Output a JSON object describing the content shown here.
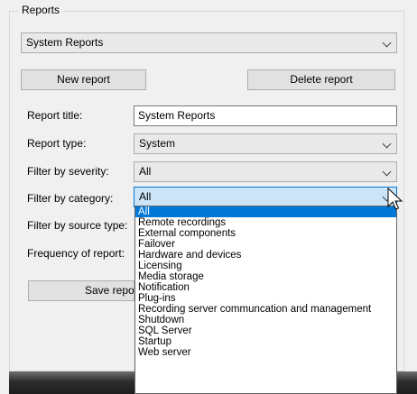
{
  "reports_group": {
    "title": "Reports",
    "selected_report": "System Reports",
    "new_report_label": "New report",
    "delete_report_label": "Delete report"
  },
  "form": {
    "report_title_label": "Report title:",
    "report_title_value": "System Reports",
    "report_type_label": "Report type:",
    "report_type_value": "System",
    "severity_label": "Filter by severity:",
    "severity_value": "All",
    "category_label": "Filter by category:",
    "category_value": "All",
    "source_type_label": "Filter by source type:",
    "frequency_label": "Frequency of report:",
    "save_label": "Save report"
  },
  "category_options": [
    "All",
    "Remote recordings",
    "External components",
    "Failover",
    "Hardware and devices",
    "Licensing",
    "Media storage",
    "Notification",
    "Plug-ins",
    "Recording server communcation and management",
    "Shutdown",
    "SQL Server",
    "Startup",
    "Web server"
  ],
  "colors": {
    "selection": "#0078d7",
    "active_combo": "#cce4f7"
  }
}
